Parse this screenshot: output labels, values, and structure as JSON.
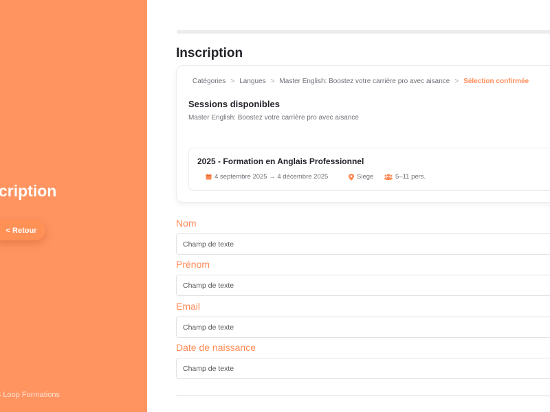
{
  "sidebar": {
    "title": "Inscription",
    "title_visible": "cription",
    "back_label": "< Retour",
    "footer": "S Loop Formations"
  },
  "header": {
    "title": "Inscription"
  },
  "breadcrumb": [
    "Catégories",
    "Langues",
    "Master English: Boostez votre carrière pro avec aisance",
    "Sélection confirmée"
  ],
  "sessions": {
    "title": "Sessions disponibles",
    "subtitle": "Master English: Boostez votre carrière pro avec aisance",
    "item": {
      "title": "2025 - Formation en Anglais Professionnel",
      "dates": "4 septembre 2025 → 4 décembre 2025",
      "location": "Siege",
      "capacity": "5–11 pers."
    }
  },
  "form": {
    "fields": [
      {
        "label": "Nom",
        "placeholder": "Champ de texte"
      },
      {
        "label": "Prénom",
        "placeholder": "Champ de texte"
      },
      {
        "label": "Email",
        "placeholder": "Champ de texte"
      },
      {
        "label": "Date de naissance",
        "placeholder": "Champ de texte"
      }
    ]
  },
  "colors": {
    "accent": "#ff9461",
    "accent_text": "#ff8a55"
  },
  "icons": [
    "calendar-icon",
    "location-pin-icon",
    "people-icon"
  ]
}
